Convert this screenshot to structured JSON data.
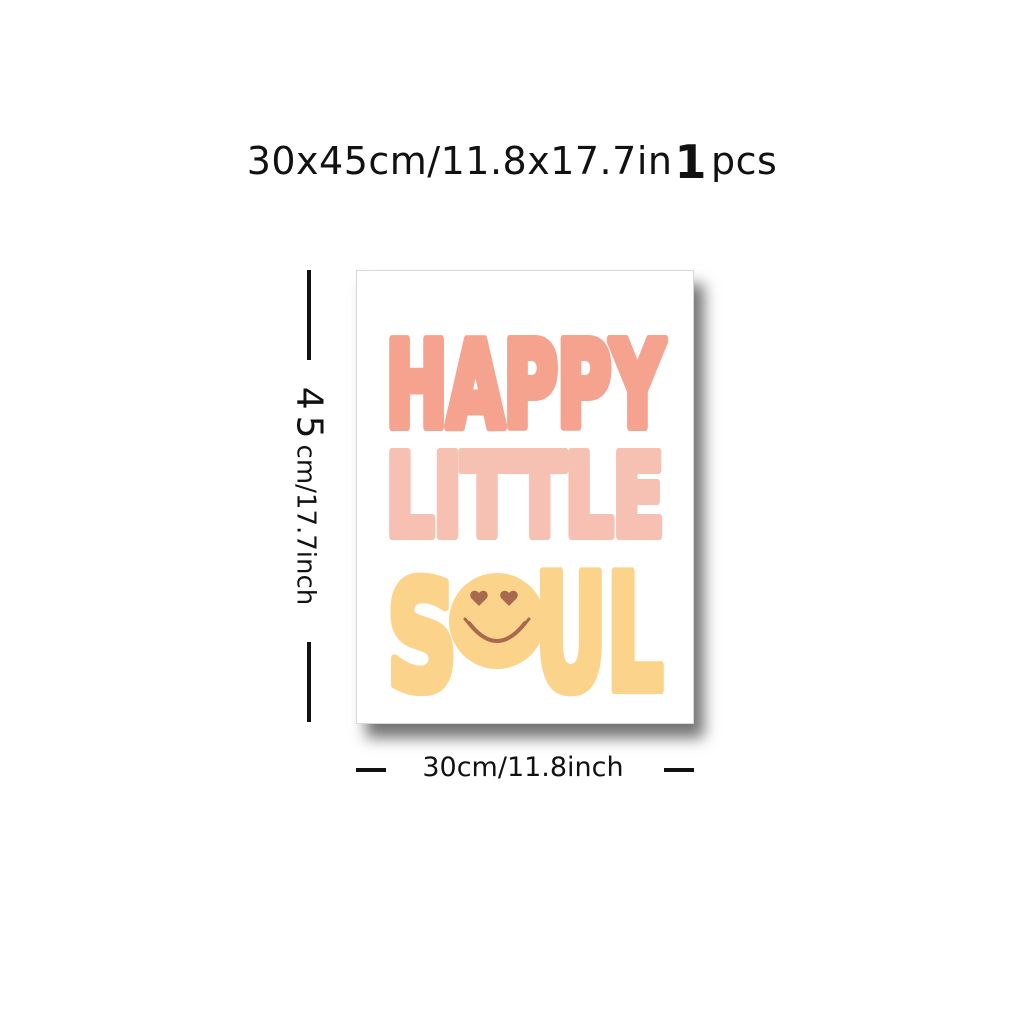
{
  "header": {
    "size_text": "30x45cm/11.8x17.7in",
    "quantity_number": "1",
    "quantity_unit": "pcs"
  },
  "dimensions": {
    "height_big": "45",
    "height_rest": "cm/17.7inch",
    "width_label": "30cm/11.8inch"
  },
  "poster": {
    "line1": "HAPPY",
    "line2": "LITTLE",
    "line3_start": "S",
    "line3_end": "UL",
    "colors": {
      "line1": "#f5a38e",
      "line2": "#f6c0b2",
      "line3": "#fcd38a",
      "smiley_face": "#fcd38a",
      "smiley_features": "#a86a4e",
      "shadow": "#000000"
    }
  }
}
